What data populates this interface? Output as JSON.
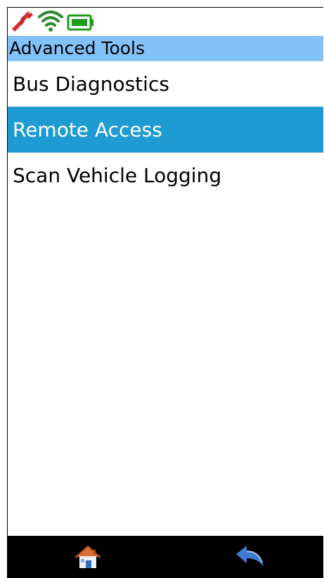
{
  "status": {
    "connection_icon": "disconnected-plug-icon",
    "wifi_icon": "wifi-icon",
    "battery_icon": "battery-icon",
    "colors": {
      "connection": "#d32f2f",
      "wifi": "#2e8b2e",
      "battery": "#1f9a1f"
    }
  },
  "header": {
    "title": "Advanced Tools",
    "background": "#83c2f8"
  },
  "menu": {
    "selected_index": 1,
    "selected_color": "#1e9bd3",
    "items": [
      {
        "label": "Bus Diagnostics"
      },
      {
        "label": "Remote Access"
      },
      {
        "label": "Scan Vehicle Logging"
      }
    ]
  },
  "footer": {
    "home_icon": "home-icon",
    "back_icon": "back-arrow-icon"
  }
}
